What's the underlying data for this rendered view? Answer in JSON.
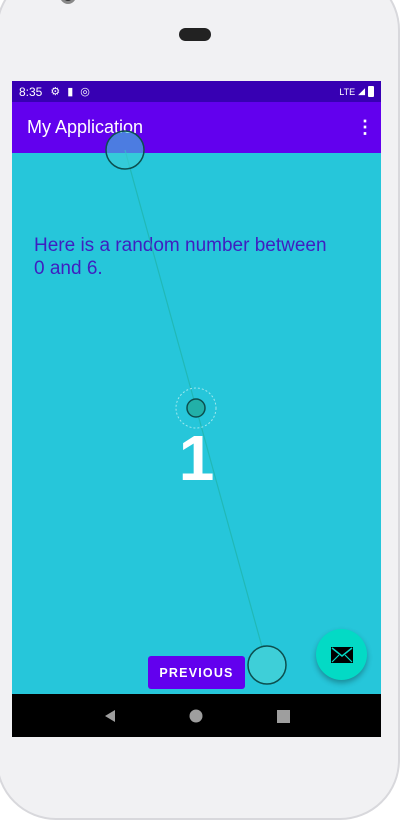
{
  "status_bar": {
    "time": "8:35",
    "icons": [
      "gear-icon",
      "sd-card-icon",
      "data-saver-icon"
    ],
    "network": "LTE",
    "right_icons": [
      "signal-icon",
      "battery-icon"
    ]
  },
  "app_bar": {
    "title": "My Application",
    "menu_icon": "more-vert-icon"
  },
  "content": {
    "message": "Here is a random number between 0 and 6.",
    "number": "1"
  },
  "buttons": {
    "previous": "PREVIOUS",
    "fab_icon": "email-icon"
  },
  "nav_bar": {
    "icons": [
      "back-icon",
      "home-icon",
      "recents-icon"
    ]
  },
  "colors": {
    "primary": "#6200ee",
    "primary_dark": "#3700b3",
    "background": "#26c6da",
    "accent": "#03dac5",
    "text": "#3f1fc0"
  }
}
